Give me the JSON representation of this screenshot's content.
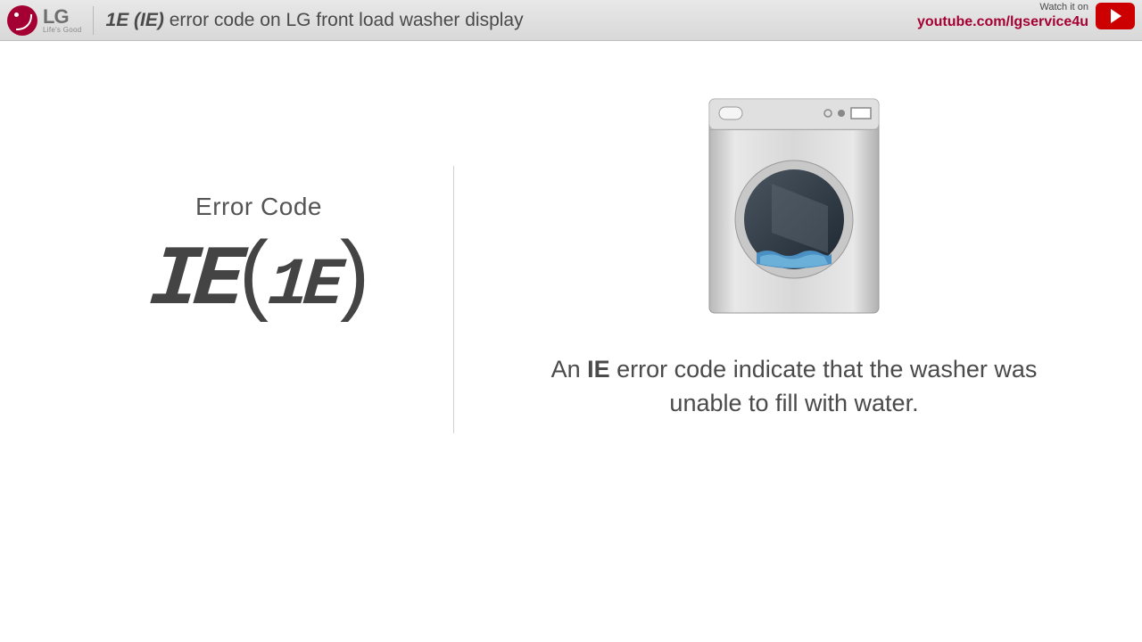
{
  "header": {
    "logo_main": "LG",
    "logo_sub": "Life's Good",
    "title_bold": "1E (IE)",
    "title_rest": " error code on LG front load washer display",
    "watch_label": "Watch it on",
    "watch_link": "youtube.com/lgservice4u"
  },
  "left": {
    "error_label": "Error Code",
    "code_main": "IE",
    "code_paren_open": "(",
    "code_sub": "1E",
    "code_paren_close": ")"
  },
  "right": {
    "explanation_pre": "An ",
    "explanation_bold": "IE",
    "explanation_post": " error code indicate that the washer was unable to fill with water."
  }
}
